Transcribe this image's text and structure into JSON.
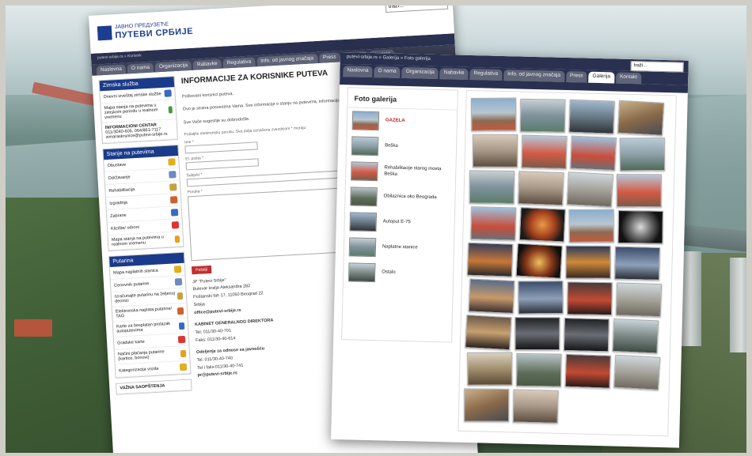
{
  "back_page": {
    "search_placeholder": "traži...",
    "logo_small": "ЈАВНО ПРЕДУЗЕЋЕ",
    "logo_big": "ПУТЕВИ СРБИЈЕ",
    "breadcrumb": "putevi-srbije.rs » Korisnik",
    "tabs": [
      "Naslovna",
      "O nama",
      "Organizacija",
      "Rabavke",
      "Regulativa",
      "Info. od javnog značaja",
      "Press",
      "Galerija",
      "Kontakt"
    ],
    "sidebar": {
      "winter_title": "Zimska služba",
      "winter_items": [
        "Dnevni izveštaj zimske službe",
        "Mapa stanja na putevima u zimskom periodu u realnom vremenu"
      ],
      "info_center_title": "INFORMACIONI CENTAR",
      "info_center_phones": "011/3040-605, 064/861-7117",
      "info_center_email": "zimaraskrsnice@putevi-srbije.rs",
      "road_title": "Stanje na putevima",
      "road_items": [
        "Obustave",
        "Održavanje",
        "Rehabilitacija",
        "Izgradnja",
        "Zabrane",
        "Klizište/ odroni",
        "Mapa stanja na putevima u realnom vremenu"
      ],
      "toll_title": "Putarina",
      "toll_items": [
        "Mapa naplatnih stanica",
        "Cenovnik putarine",
        "Izračunajte putarinu na željenoj deonici",
        "Elektronska naplata putarine/ TAG",
        "Karte za besplatan prolazak autoputevima",
        "Gradske karte",
        "Načini plaćanja putarine (kartice, bonovi)",
        "Kategorizacija vozila"
      ],
      "notice": "VAŽNA SAOPŠTENJA"
    },
    "main": {
      "title": "INFORMACIJE ZA KORISNIKE PUTEVA",
      "greeting": "Poštovani korisnici puteva,",
      "intro": "Ovo je strana posvećena Vama. Sve informacije o stanju na putevima, informacije možete pronaći u menijima sa leve strane ekrana.",
      "welcome": "Sve Vaše sugestije su dobrodošle.",
      "form_note": "Pošaljite elektronsku poruku. Sva polja označena zvezdicom * moraju",
      "field_name": "Ime *",
      "field_email": "El. pošta *",
      "field_subject": "Subjekt *",
      "field_message": "Poruka *",
      "send_button": "Pošalji",
      "company": "JP \"Putevi Srbije\"",
      "address1": "Bulevar kralja Aleksandra 282",
      "address2": "Poštanski fah 17, 11050 Beograd 22",
      "country": "Srbija",
      "email": "office@putevi-srbije.rs",
      "cabinet_title": "KABINET GENERALNOG DIREKTORA",
      "cabinet_tel": "Tel: 011/30-40-701",
      "cabinet_fax": "Faks: 011/30-40-614",
      "pr_title": "Odeljenje za odnose sa javnošću",
      "pr_tel": "Tel: 011/30-40-740",
      "pr_telfax": "Tel i faks:011/30-40-741",
      "pr_email": "pr@putevi-srbije.rs"
    }
  },
  "front_page": {
    "breadcrumb": "putevi-srbije.rs » Galerija » Foto galerija",
    "search_placeholder": "traži...",
    "tabs": [
      "Naslovna",
      "O nama",
      "Organizacija",
      "Nabavke",
      "Regulativa",
      "Info. od javnog značaja",
      "Press",
      "Galerija",
      "Kontakt"
    ],
    "active_tab": "Galerija",
    "gallery_title": "Foto galerija",
    "albums": [
      "GAZELA",
      "Beška",
      "Rehabilitacije starog mosta Beška",
      "Obilaznica oko Beograda",
      "Autoput E-75",
      "Naplatne stanice",
      "Ostalo"
    ],
    "album_thumb_colors": [
      "c-a",
      "c-h",
      "c-f",
      "c-v",
      "c-c",
      "c-b",
      "c-t"
    ],
    "thumbnails": [
      "c-a",
      "c-b",
      "c-c",
      "c-d",
      "c-e",
      "c-f",
      "c-g",
      "c-h",
      "c-b",
      "c-e",
      "c-q",
      "c-f",
      "c-g",
      "c-i",
      "c-a",
      "c-j",
      "c-k",
      "c-l",
      "c-m",
      "c-n",
      "c-o",
      "c-n",
      "c-p",
      "c-q",
      "c-r",
      "c-s",
      "c-s",
      "c-t",
      "c-u",
      "c-v",
      "c-p",
      "c-q",
      "c-d",
      "c-e"
    ]
  }
}
